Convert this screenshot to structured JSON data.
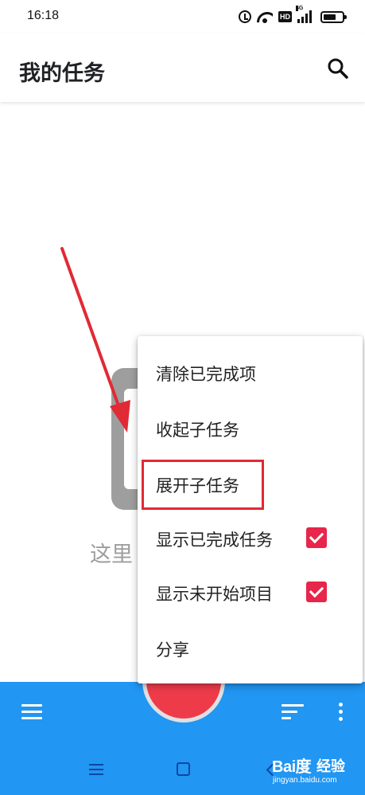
{
  "status_bar": {
    "time": "16:18",
    "icons": [
      "alarm-icon",
      "wifi-icon",
      "hd-icon",
      "signal-icon",
      "battery-icon"
    ],
    "hd_label": "HD",
    "network_label": "4G"
  },
  "app_bar": {
    "title": "我的任务",
    "search_icon": "search-icon"
  },
  "empty_state": {
    "text": "这里"
  },
  "popup_menu": {
    "items": [
      {
        "label": "清除已完成项"
      },
      {
        "label": "收起子任务"
      },
      {
        "label": "展开子任务",
        "highlighted": true
      },
      {
        "label": "显示已完成任务",
        "checked": true
      },
      {
        "label": "显示未开始项目",
        "checked": true
      },
      {
        "label": "分享"
      }
    ]
  },
  "bottom_bar": {
    "menu_icon": "menu-icon",
    "add_icon": "add-icon",
    "sort_icon": "sort-icon",
    "more_icon": "more-vert-icon"
  },
  "nav_bar": {
    "icons": [
      "recent-apps-icon",
      "home-icon",
      "back-icon"
    ]
  },
  "watermark": {
    "logo": "Bai度",
    "sub": "经验",
    "url": "jingyan.baidu.com"
  },
  "colors": {
    "accent_blue": "#2196f3",
    "fab_red": "#ee3b4a",
    "check_red": "#e8254a",
    "annotation_red": "#e02a35"
  }
}
